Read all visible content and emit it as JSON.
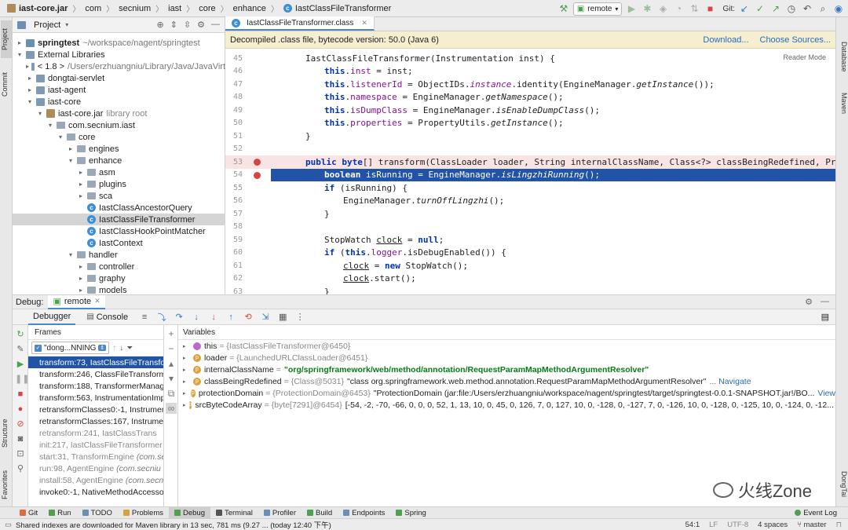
{
  "breadcrumbs": [
    "iast-core.jar",
    "com",
    "secnium",
    "iast",
    "core",
    "enhance",
    "IastClassFileTransformer"
  ],
  "toolbar": {
    "run_config": "remote",
    "git_label": "Git:"
  },
  "left_strip": [
    "Project",
    "Commit",
    "Structure",
    "Favorites"
  ],
  "right_strip": [
    "Database",
    "Maven",
    "DongTai"
  ],
  "project": {
    "title": "Project",
    "tree": [
      {
        "label": "springtest",
        "path": "~/workspace/nagent/springtest",
        "indent": 1,
        "arrow": "▸",
        "icon": "mod",
        "bold": true
      },
      {
        "label": "External Libraries",
        "indent": 1,
        "arrow": "▾",
        "icon": "lib"
      },
      {
        "label": "< 1.8 >",
        "path": "/Users/erzhuangniu/Library/Java/JavaVirt",
        "indent": 2,
        "arrow": "▸",
        "icon": "lib"
      },
      {
        "label": "dongtai-servlet",
        "indent": 2,
        "arrow": "▸",
        "icon": "lib"
      },
      {
        "label": "iast-agent",
        "indent": 2,
        "arrow": "▸",
        "icon": "lib"
      },
      {
        "label": "iast-core",
        "indent": 2,
        "arrow": "▾",
        "icon": "lib"
      },
      {
        "label": "iast-core.jar",
        "hint": "library root",
        "indent": 3,
        "arrow": "▾",
        "icon": "jar"
      },
      {
        "label": "com.secnium.iast",
        "indent": 4,
        "arrow": "▾",
        "icon": "pkg"
      },
      {
        "label": "core",
        "indent": 5,
        "arrow": "▾",
        "icon": "pkg"
      },
      {
        "label": "engines",
        "indent": 6,
        "arrow": "▸",
        "icon": "pkg"
      },
      {
        "label": "enhance",
        "indent": 6,
        "arrow": "▾",
        "icon": "pkg"
      },
      {
        "label": "asm",
        "indent": 7,
        "arrow": "▸",
        "icon": "pkg"
      },
      {
        "label": "plugins",
        "indent": 7,
        "arrow": "▸",
        "icon": "pkg"
      },
      {
        "label": "sca",
        "indent": 7,
        "arrow": "▸",
        "icon": "pkg"
      },
      {
        "label": "IastClassAncestorQuery",
        "indent": 7,
        "arrow": "",
        "icon": "class"
      },
      {
        "label": "IastClassFileTransformer",
        "indent": 7,
        "arrow": "",
        "icon": "class",
        "selected": true
      },
      {
        "label": "IastClassHookPointMatcher",
        "indent": 7,
        "arrow": "",
        "icon": "class"
      },
      {
        "label": "IastContext",
        "indent": 7,
        "arrow": "",
        "icon": "class"
      },
      {
        "label": "handler",
        "indent": 6,
        "arrow": "▾",
        "icon": "pkg"
      },
      {
        "label": "controller",
        "indent": 7,
        "arrow": "▸",
        "icon": "pkg"
      },
      {
        "label": "graphy",
        "indent": 7,
        "arrow": "▸",
        "icon": "pkg"
      },
      {
        "label": "models",
        "indent": 7,
        "arrow": "▸",
        "icon": "pkg"
      }
    ]
  },
  "editor": {
    "tab": "IastClassFileTransformer.class",
    "banner": "Decompiled .class file, bytecode version: 50.0 (Java 6)",
    "banner_links": [
      "Download...",
      "Choose Sources..."
    ],
    "reader_mode": "Reader Mode",
    "lines": [
      {
        "n": "45",
        "html": "IastClassFileTransformer(Instrumentation inst) {",
        "indent": 1
      },
      {
        "n": "46",
        "html": "<span class='kw'>this</span>.<span class='fld'>inst</span> = inst;",
        "indent": 2
      },
      {
        "n": "47",
        "html": "<span class='kw'>this</span>.<span class='fld'>listenerId</span> = ObjectIDs.<span class='it fld'>instance</span>.identity(EngineManager.<span class='it'>getInstance</span>());",
        "indent": 2
      },
      {
        "n": "48",
        "html": "<span class='kw'>this</span>.<span class='fld'>namespace</span> = EngineManager.<span class='it'>getNamespace</span>();",
        "indent": 2
      },
      {
        "n": "49",
        "html": "<span class='kw'>this</span>.<span class='fld'>isDumpClass</span> = EngineManager.<span class='it'>isEnableDumpClass</span>();",
        "indent": 2
      },
      {
        "n": "50",
        "html": "<span class='kw'>this</span>.<span class='fld'>properties</span> = PropertyUtils.<span class='it'>getInstance</span>();",
        "indent": 2
      },
      {
        "n": "51",
        "html": "}",
        "indent": 1
      },
      {
        "n": "52",
        "html": "",
        "indent": 0
      },
      {
        "n": "53",
        "html": "<span class='kw'>public byte</span>[] transform(ClassLoader loader, String internalClassName, Class&lt;?&gt; classBeingRedefined, ProtectionDomai",
        "indent": 1,
        "bp": true
      },
      {
        "n": "54",
        "html": "<span class='kw'>boolean</span> isRunning = EngineManager.<span class='it'>isLingzhiRunning</span>();",
        "indent": 2,
        "exec": true
      },
      {
        "n": "55",
        "html": "<span class='kw'>if</span> (isRunning) {",
        "indent": 2
      },
      {
        "n": "56",
        "html": "EngineManager.<span class='it'>turnOffLingzhi</span>();",
        "indent": 3
      },
      {
        "n": "57",
        "html": "}",
        "indent": 2
      },
      {
        "n": "58",
        "html": "",
        "indent": 0
      },
      {
        "n": "59",
        "html": "StopWatch <u>clock</u> = <span class='kw'>null</span>;",
        "indent": 2
      },
      {
        "n": "60",
        "html": "<span class='kw'>if</span> (<span class='kw'>this</span>.<span class='fld'>logger</span>.isDebugEnabled()) {",
        "indent": 2
      },
      {
        "n": "61",
        "html": "<u>clock</u> = <span class='kw'>new</span> StopWatch();",
        "indent": 3
      },
      {
        "n": "62",
        "html": "<u>clock</u>.start();",
        "indent": 3
      },
      {
        "n": "63",
        "html": "}",
        "indent": 2
      }
    ]
  },
  "debug": {
    "label": "Debug:",
    "session": "remote",
    "tabs": [
      "Debugger",
      "Console"
    ],
    "frames_header": "Frames",
    "variables_header": "Variables",
    "thread": "\"dong...NNING",
    "frames": [
      {
        "text": "transform:73, IastClassFileTransfor",
        "cls": "",
        "sel": true
      },
      {
        "text": "transform:246, ClassFileTransforme",
        "cls": ""
      },
      {
        "text": "transform:188, TransformerManage",
        "cls": ""
      },
      {
        "text": "transform:563, InstrumentationImp",
        "cls": ""
      },
      {
        "text": "retransformClasses0:-1, Instrumen",
        "cls": ""
      },
      {
        "text": "retransformClasses:167, Instrumen",
        "cls": ""
      },
      {
        "text": "retransform:241, IastClassTrans",
        "cls": "",
        "dim": true
      },
      {
        "text": "init:217, IastClassFileTransformer",
        "cls": "(c",
        "dim": true
      },
      {
        "text": "start:31, TransformEngine",
        "cls": "(com.se",
        "dim": true
      },
      {
        "text": "run:98, AgentEngine",
        "cls": "(com.secniu",
        "dim": true
      },
      {
        "text": "install:58, AgentEngine",
        "cls": "(com.secn",
        "dim": true
      },
      {
        "text": "invoke0:-1, NativeMethodAccesso",
        "cls": ""
      }
    ],
    "variables": [
      {
        "icon": "t",
        "name": "this",
        "ref": "= {IastClassFileTransformer@6450}",
        "value": "",
        "str": false
      },
      {
        "icon": "p",
        "name": "loader",
        "ref": "= {LaunchedURLClassLoader@6451}",
        "value": "",
        "str": false
      },
      {
        "icon": "p",
        "name": "internalClassName",
        "ref": "=",
        "value": "\"org/springframework/web/method/annotation/RequestParamMapMethodArgumentResolver\"",
        "str": true
      },
      {
        "icon": "p",
        "name": "classBeingRedefined",
        "ref": "= {Class@5031}",
        "value": "\"class org.springframework.web.method.annotation.RequestParamMapMethodArgumentResolver\"",
        "link": "... Navigate",
        "str": false
      },
      {
        "icon": "p",
        "name": "protectionDomain",
        "ref": "= {ProtectionDomain@6453}",
        "value": "\"ProtectionDomain  (jar:file:/Users/erzhuangniu/workspace/nagent/springtest/target/springtest-0.0.1-SNAPSHOT.jar!/BO...",
        "link": "View",
        "str": false
      },
      {
        "icon": "p",
        "name": "srcByteCodeArray",
        "ref": "= {byte[7291]@6454}",
        "value": "[-54, -2, -70, -66, 0, 0, 0, 52, 1, 13, 10, 0, 45, 0, 126, 7, 0, 127, 10, 0, -128, 0, -127, 7, 0, -126, 10, 0, -128, 0, -125, 10, 0, -124, 0, -12...",
        "link": "View",
        "str": false
      }
    ],
    "watermark": "火线Zone"
  },
  "bottom_tabs": [
    {
      "label": "Git",
      "color": "#e06c3c"
    },
    {
      "label": "Run",
      "color": "#4fa04f"
    },
    {
      "label": "TODO",
      "color": "#6b8fb4"
    },
    {
      "label": "Problems",
      "color": "#d9a13a"
    },
    {
      "label": "Debug",
      "color": "#4fa04f",
      "active": true
    },
    {
      "label": "Terminal",
      "color": "#555555"
    },
    {
      "label": "Profiler",
      "color": "#6b8fb4"
    },
    {
      "label": "Build",
      "color": "#4fa04f"
    },
    {
      "label": "Endpoints",
      "color": "#6b8fb4"
    },
    {
      "label": "Spring",
      "color": "#4fa04f"
    }
  ],
  "event_log": "Event Log",
  "status": {
    "message": "Shared indexes are downloaded for Maven library in 13 sec, 781 ms (9.27 ... (today 12:40 下午)",
    "position": "54:1",
    "line_sep": "LF",
    "encoding": "UTF-8",
    "indent": "4 spaces",
    "branch": "master"
  }
}
